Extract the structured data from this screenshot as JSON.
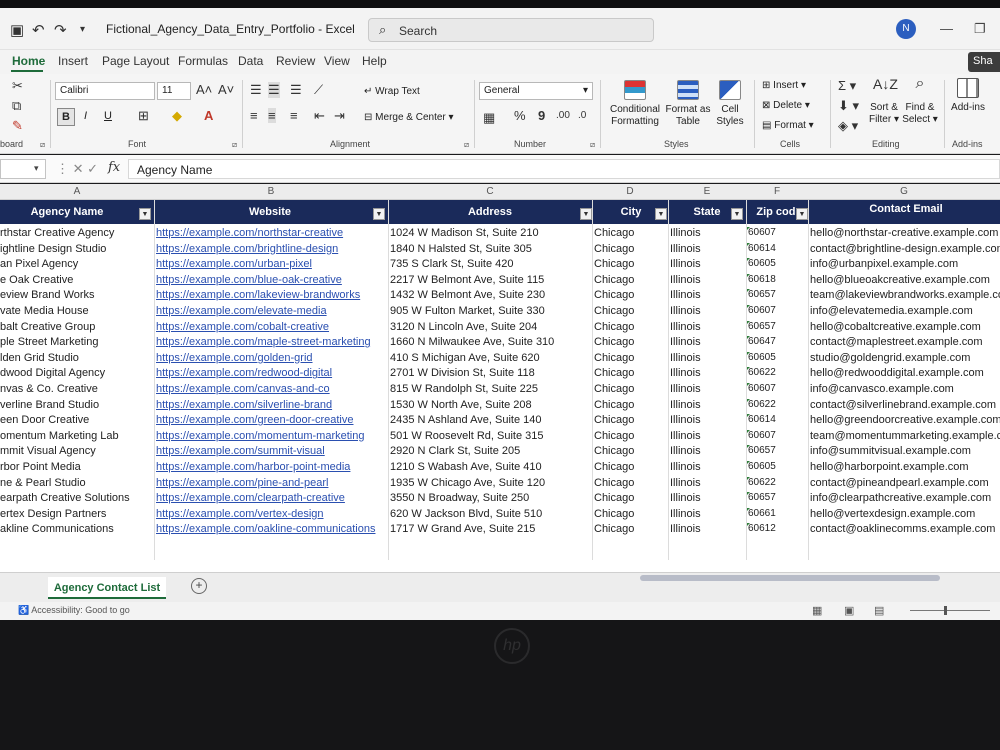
{
  "window": {
    "title": "Fictional_Agency_Data_Entry_Portfolio - Excel",
    "search_placeholder": "Search",
    "user_initial": "N"
  },
  "tabs": [
    {
      "label": "Home",
      "active": true
    },
    {
      "label": "Insert"
    },
    {
      "label": "Page Layout"
    },
    {
      "label": "Formulas"
    },
    {
      "label": "Data"
    },
    {
      "label": "Review"
    },
    {
      "label": "View"
    },
    {
      "label": "Help"
    }
  ],
  "share_label": "Sha",
  "ribbon": {
    "clipboard_label": "board",
    "font": {
      "name": "Calibri",
      "size": "11",
      "group_label": "Font",
      "bold": "B",
      "italic": "I",
      "underline": "U"
    },
    "alignment": {
      "wrap_text": "Wrap Text",
      "merge_center": "Merge & Center",
      "group_label": "Alignment"
    },
    "number": {
      "format": "General",
      "percent": "%",
      "comma": "9",
      "group_label": "Number"
    },
    "styles": {
      "conditional": "Conditional",
      "conditional2": "Formatting",
      "format_as": "Format as",
      "format_as2": "Table",
      "cell": "Cell",
      "cell2": "Styles",
      "group_label": "Styles"
    },
    "cells": {
      "insert": "Insert",
      "delete": "Delete",
      "format": "Format",
      "group_label": "Cells"
    },
    "editing": {
      "sort": "Sort &",
      "sort2": "Filter",
      "find": "Find &",
      "find2": "Select",
      "group_label": "Editing"
    },
    "addins": {
      "label": "Add-ins",
      "group_label": "Add-ins"
    }
  },
  "formula_bar": {
    "fx": "fx",
    "content": "Agency Name"
  },
  "columns": [
    "A",
    "B",
    "C",
    "D",
    "E",
    "F",
    "G"
  ],
  "table": {
    "headers": [
      "Agency Name",
      "Website",
      "Address",
      "City",
      "State",
      "Zip code",
      "Contact Email"
    ],
    "rows": [
      [
        "rthstar Creative Agency",
        "https://example.com/northstar-creative",
        "1024 W Madison St, Suite 210",
        "Chicago",
        "Illinois",
        "60607",
        "hello@northstar-creative.example.com"
      ],
      [
        "ightline Design Studio",
        "https://example.com/brightline-design",
        "1840 N Halsted St, Suite 305",
        "Chicago",
        "Illinois",
        "60614",
        "contact@brightline-design.example.com"
      ],
      [
        "an Pixel Agency",
        "https://example.com/urban-pixel",
        "735 S Clark St, Suite 420",
        "Chicago",
        "Illinois",
        "60605",
        "info@urbanpixel.example.com"
      ],
      [
        "e Oak Creative",
        "https://example.com/blue-oak-creative",
        "2217 W Belmont Ave, Suite 115",
        "Chicago",
        "Illinois",
        "60618",
        "hello@blueoakcreative.example.com"
      ],
      [
        "eview Brand Works",
        "https://example.com/lakeview-brandworks",
        "1432 W Belmont Ave, Suite 230",
        "Chicago",
        "Illinois",
        "60657",
        "team@lakeviewbrandworks.example.co"
      ],
      [
        "vate Media House",
        "https://example.com/elevate-media",
        "905 W Fulton Market, Suite 330",
        "Chicago",
        "Illinois",
        "60607",
        "info@elevatemedia.example.com"
      ],
      [
        "balt Creative Group",
        "https://example.com/cobalt-creative",
        "3120 N Lincoln Ave, Suite 204",
        "Chicago",
        "Illinois",
        "60657",
        "hello@cobaltcreative.example.com"
      ],
      [
        "ple Street Marketing",
        "https://example.com/maple-street-marketing",
        "1660 N Milwaukee Ave, Suite 310",
        "Chicago",
        "Illinois",
        "60647",
        "contact@maplestreet.example.com"
      ],
      [
        "lden Grid Studio",
        "https://example.com/golden-grid",
        "410 S Michigan Ave, Suite 620",
        "Chicago",
        "Illinois",
        "60605",
        "studio@goldengrid.example.com"
      ],
      [
        "dwood Digital Agency",
        "https://example.com/redwood-digital",
        "2701 W Division St, Suite 118",
        "Chicago",
        "Illinois",
        "60622",
        "hello@redwooddigital.example.com"
      ],
      [
        "nvas & Co. Creative",
        "https://example.com/canvas-and-co",
        "815 W Randolph St, Suite 225",
        "Chicago",
        "Illinois",
        "60607",
        "info@canvasco.example.com"
      ],
      [
        "verline Brand Studio",
        "https://example.com/silverline-brand",
        "1530 W North Ave, Suite 208",
        "Chicago",
        "Illinois",
        "60622",
        "contact@silverlinebrand.example.com"
      ],
      [
        "een Door Creative",
        "https://example.com/green-door-creative",
        "2435 N Ashland Ave, Suite 140",
        "Chicago",
        "Illinois",
        "60614",
        "hello@greendoorcreative.example.com"
      ],
      [
        "omentum Marketing Lab",
        "https://example.com/momentum-marketing",
        "501 W Roosevelt Rd, Suite 315",
        "Chicago",
        "Illinois",
        "60607",
        "team@momentummarketing.example.c"
      ],
      [
        "mmit Visual Agency",
        "https://example.com/summit-visual",
        "2920 N Clark St, Suite 205",
        "Chicago",
        "Illinois",
        "60657",
        "info@summitvisual.example.com"
      ],
      [
        "rbor Point Media",
        "https://example.com/harbor-point-media",
        "1210 S Wabash Ave, Suite 410",
        "Chicago",
        "Illinois",
        "60605",
        "hello@harborpoint.example.com"
      ],
      [
        "ne & Pearl Studio",
        "https://example.com/pine-and-pearl",
        "1935 W Chicago Ave, Suite 120",
        "Chicago",
        "Illinois",
        "60622",
        "contact@pineandpearl.example.com"
      ],
      [
        "earpath Creative Solutions",
        "https://example.com/clearpath-creative",
        "3550 N Broadway, Suite 250",
        "Chicago",
        "Illinois",
        "60657",
        "info@clearpathcreative.example.com"
      ],
      [
        "ertex Design Partners",
        "https://example.com/vertex-design",
        "620 W Jackson Blvd, Suite 510",
        "Chicago",
        "Illinois",
        "60661",
        "hello@vertexdesign.example.com"
      ],
      [
        "akline Communications",
        "https://example.com/oakline-communications",
        "1717 W Grand Ave, Suite 215",
        "Chicago",
        "Illinois",
        "60612",
        "contact@oaklinecomms.example.com"
      ]
    ]
  },
  "sheet_tab": "Agency Contact List",
  "status": {
    "accessibility": "Accessibility: Good to go"
  },
  "colors": {
    "header_bg": "#1a2a5a",
    "accent": "#1e6b3a",
    "link": "#2a4fb0"
  }
}
